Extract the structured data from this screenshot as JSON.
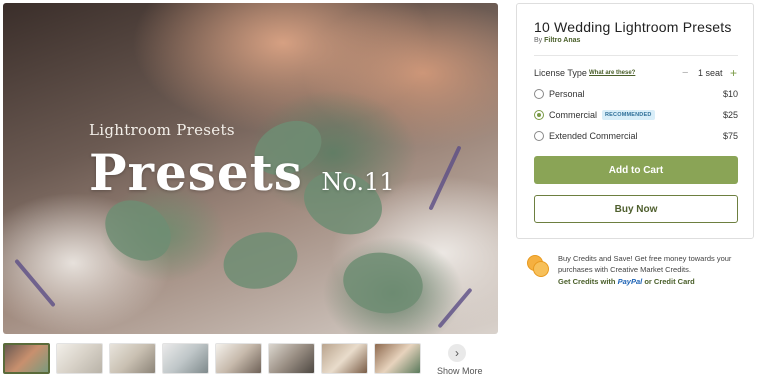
{
  "hero": {
    "kicker": "Lightroom Presets",
    "title": "Presets",
    "number": "No.11"
  },
  "thumbnails": {
    "count": 8,
    "show_more_label": "Show More"
  },
  "product": {
    "title": "10 Wedding Lightroom Presets",
    "by_prefix": "By",
    "author": "Filtro Anas",
    "license_label": "License Type",
    "license_link": "What are these?",
    "seat_value": "1 seat",
    "options": [
      {
        "label": "Personal",
        "price": "$10",
        "selected": false
      },
      {
        "label": "Commercial",
        "price": "$25",
        "selected": true,
        "badge": "RECOMMENDED"
      },
      {
        "label": "Extended Commercial",
        "price": "$75",
        "selected": false
      }
    ],
    "add_to_cart": "Add to Cart",
    "buy_now": "Buy Now"
  },
  "credits": {
    "text": "Buy Credits and Save! Get free money towards your purchases with Creative Market Credits.",
    "link_prefix": "Get Credits with",
    "paypal": "PayPal",
    "link_suffix": "or Credit Card"
  },
  "colors": {
    "accent": "#8aa456",
    "link": "#4a5f2a",
    "badge_bg": "#d9eef9",
    "badge_text": "#2f6f98",
    "paypal": "#1d63b5",
    "coin": "#f5b040"
  },
  "icons": [
    "plus-icon",
    "minus-icon",
    "chevron-right-icon",
    "credits-coin-icon"
  ]
}
